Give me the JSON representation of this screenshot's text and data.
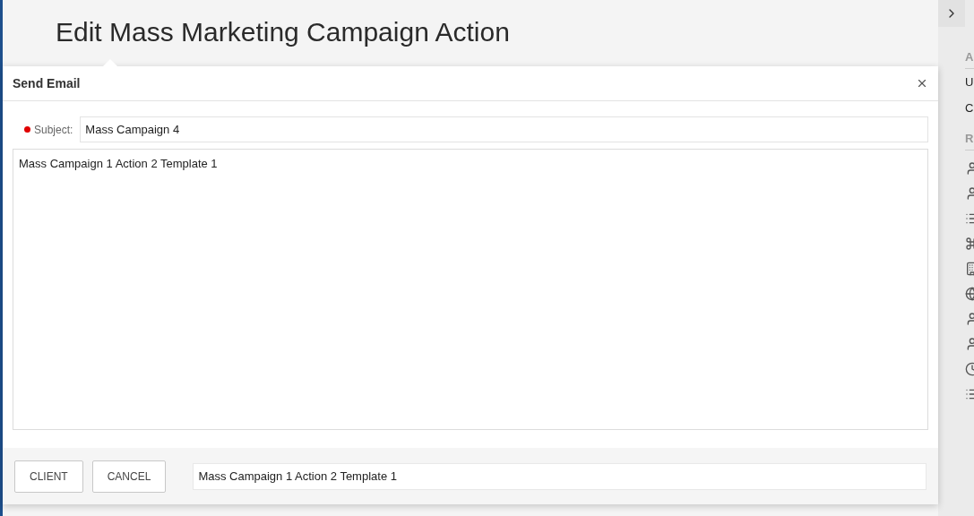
{
  "page": {
    "title": "Edit Mass Marketing Campaign Action"
  },
  "dialog": {
    "title": "Send Email",
    "subject": {
      "label": "Subject:",
      "required": true,
      "value": "Mass Campaign 4"
    },
    "body": "Mass Campaign 1 Action 2 Template 1",
    "buttons": [
      "CLIENT",
      "CANCEL"
    ],
    "template_field": "Mass Campaign 1 Action 2 Template 1"
  },
  "sidebar": {
    "sections": [
      {
        "heading": "A",
        "items": [
          "U",
          "C"
        ]
      },
      {
        "heading": "R"
      }
    ],
    "icons": [
      {
        "kind": "person"
      },
      {
        "kind": "person"
      },
      {
        "kind": "list"
      },
      {
        "kind": "command"
      },
      {
        "kind": "building"
      },
      {
        "kind": "globe"
      },
      {
        "kind": "person"
      },
      {
        "kind": "person"
      },
      {
        "kind": "clock"
      },
      {
        "kind": "list"
      }
    ]
  }
}
